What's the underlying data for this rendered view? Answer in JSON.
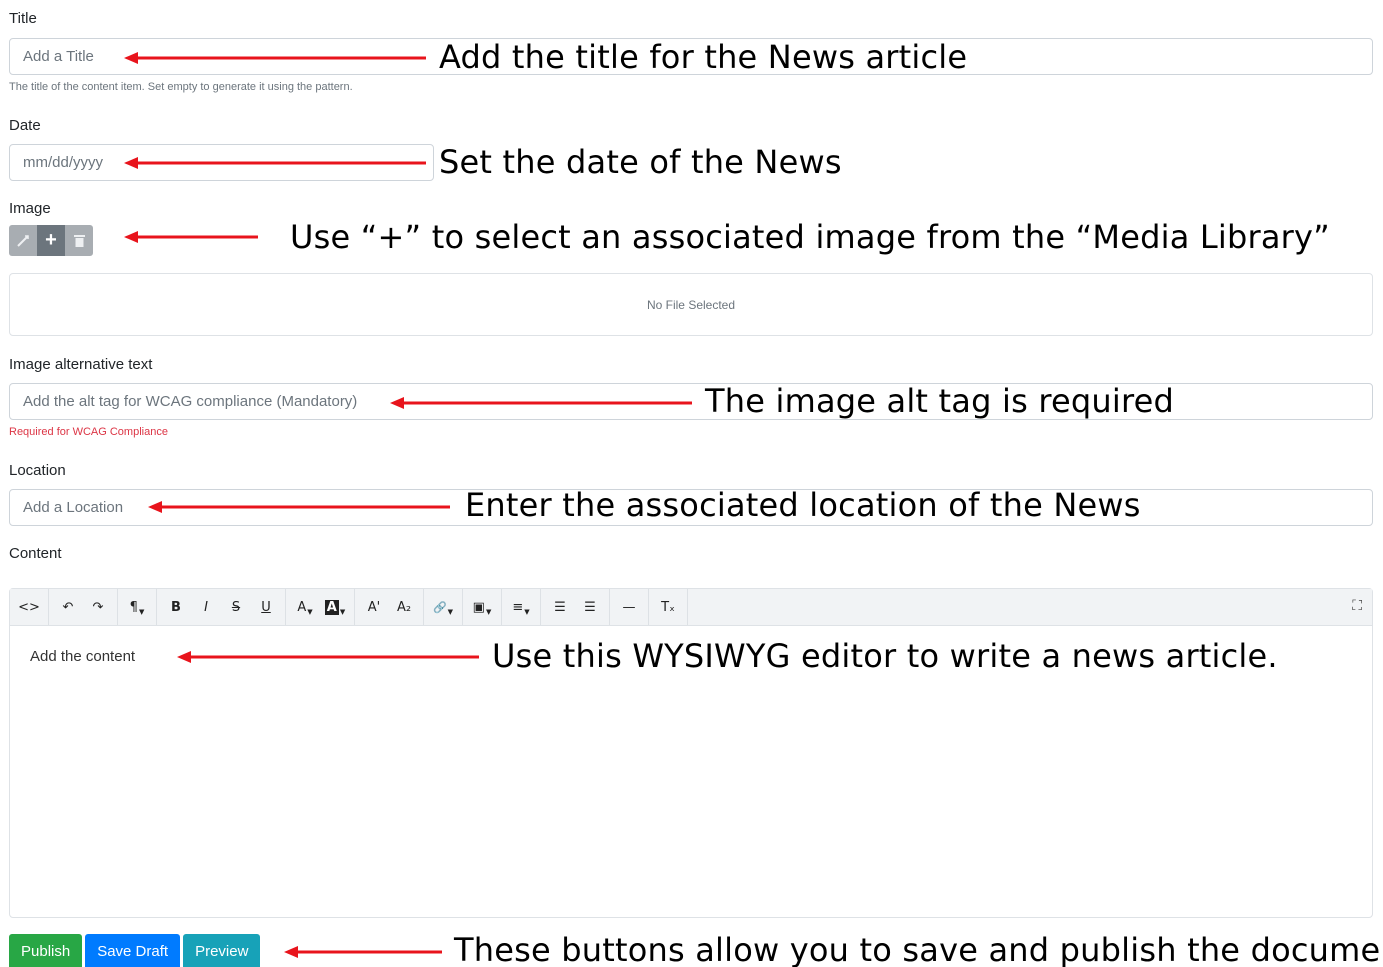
{
  "title_field": {
    "label": "Title",
    "placeholder": "Add a Title",
    "help": "The title of the content item. Set empty to generate it using the pattern.",
    "annotation": "Add the title for the News article"
  },
  "date_field": {
    "label": "Date",
    "placeholder": "mm/dd/yyyy",
    "annotation": "Set the date of the News"
  },
  "image_field": {
    "label": "Image",
    "buttons": [
      "crop-icon",
      "plus-icon",
      "trash-icon"
    ],
    "add_symbol": "+",
    "empty_text": "No File Selected",
    "annotation": "Use “+” to select an associated image from the “Media Library”"
  },
  "alt_field": {
    "label": "Image alternative text",
    "placeholder": "Add the alt tag for WCAG compliance (Mandatory)",
    "help": "Required for WCAG Compliance",
    "annotation": "The image alt tag is required"
  },
  "location_field": {
    "label": "Location",
    "placeholder": "Add a Location",
    "annotation": "Enter the associated location of the News"
  },
  "content_field": {
    "label": "Content",
    "body": "Add the content",
    "annotation": "Use this WYSIWYG editor to write a news article.",
    "toolbar": {
      "code": "<>",
      "undo": "↶",
      "redo": "↷",
      "paragraph": "¶",
      "bold": "B",
      "italic": "I",
      "strike": "S",
      "underline": "U",
      "font_color": "A",
      "bg_color": "A",
      "superscript": "A'",
      "subscript": "A₂",
      "link": "🔗",
      "image": "▣",
      "align": "≡",
      "ul": "☰",
      "ol": "☰",
      "hr": "—",
      "clear": "Tₓ",
      "fullscreen": "⛶"
    }
  },
  "actions": {
    "publish": "Publish",
    "save_draft": "Save Draft",
    "preview": "Preview",
    "annotation": "These buttons allow you to save and publish the document"
  },
  "colors": {
    "annotation_arrow": "#e8141c",
    "publish": "#28a745",
    "save_draft": "#007bff",
    "preview": "#17a2b8",
    "error": "#dc3545"
  }
}
